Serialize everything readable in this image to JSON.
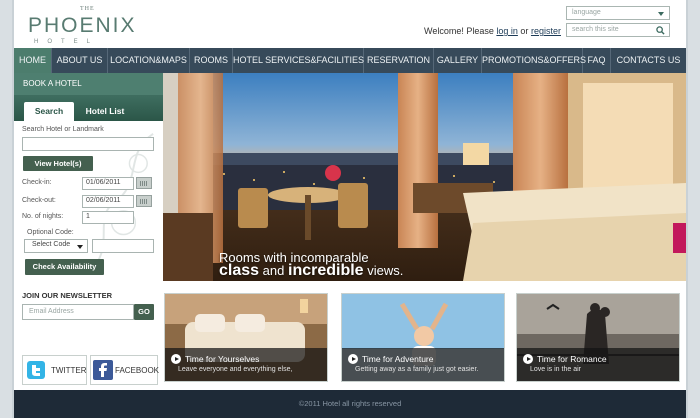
{
  "logo": {
    "the": "THE",
    "name": "PHOENIX",
    "sub": "HOTEL"
  },
  "header": {
    "language_placeholder": "language",
    "search_placeholder": "search this site",
    "welcome_text": "Welcome! Please",
    "login_link": "log in",
    "or_text": "or",
    "register_link": "register"
  },
  "nav": {
    "items": [
      {
        "label": "HOME"
      },
      {
        "label": "ABOUT US"
      },
      {
        "label": "LOCATION&MAPS"
      },
      {
        "label": "ROOMS"
      },
      {
        "label": "HOTEL SERVICES&FACILITIES"
      },
      {
        "label": "RESERVATION"
      },
      {
        "label": "GALLERY"
      },
      {
        "label": "PROMOTIONS&OFFERS"
      },
      {
        "label": "FAQ"
      },
      {
        "label": "CONTACTS US"
      }
    ]
  },
  "booking": {
    "title": "BOOK A HOTEL",
    "tabs": [
      {
        "label": "Search"
      },
      {
        "label": "Hotel List"
      }
    ],
    "search_label": "Search Hotel or Landmark",
    "search_value": "",
    "view_button": "View Hotel(s)",
    "checkin_label": "Check-in:",
    "checkin_value": "01/06/2011",
    "checkout_label": "Check-out:",
    "checkout_value": "02/06/2011",
    "nights_label": "No. of nights:",
    "nights_value": "1",
    "code_label": "Optional Code:",
    "code_select": "Select Code",
    "code_value": "",
    "availability_button": "Check Availability"
  },
  "hero": {
    "caption_line1": "Rooms with incomparable",
    "caption_class": "class",
    "caption_and": "and",
    "caption_incredible": "incredible",
    "caption_views": "views."
  },
  "newsletter": {
    "title": "JOIN OUR NEWSLETTER",
    "email_placeholder": "Email Address",
    "go_button": "GO"
  },
  "social": {
    "twitter": "TWITTER",
    "facebook": "FACEBOOK"
  },
  "cards": [
    {
      "title": "Time for Yourselves",
      "subtitle": "Leave everyone and everything else,"
    },
    {
      "title": "Time for Adventure",
      "subtitle": "Getting away as a family just got easier."
    },
    {
      "title": "Time for Romance",
      "subtitle": "Love is in the air"
    }
  ],
  "footer": {
    "copyright": "©2011 Hotel all rights reserved"
  },
  "colors": {
    "nav_bg": "#374a5a",
    "nav_active": "#4c7d6d",
    "brand_green": "#4e7f70",
    "footer_bg": "#1e2a37"
  }
}
